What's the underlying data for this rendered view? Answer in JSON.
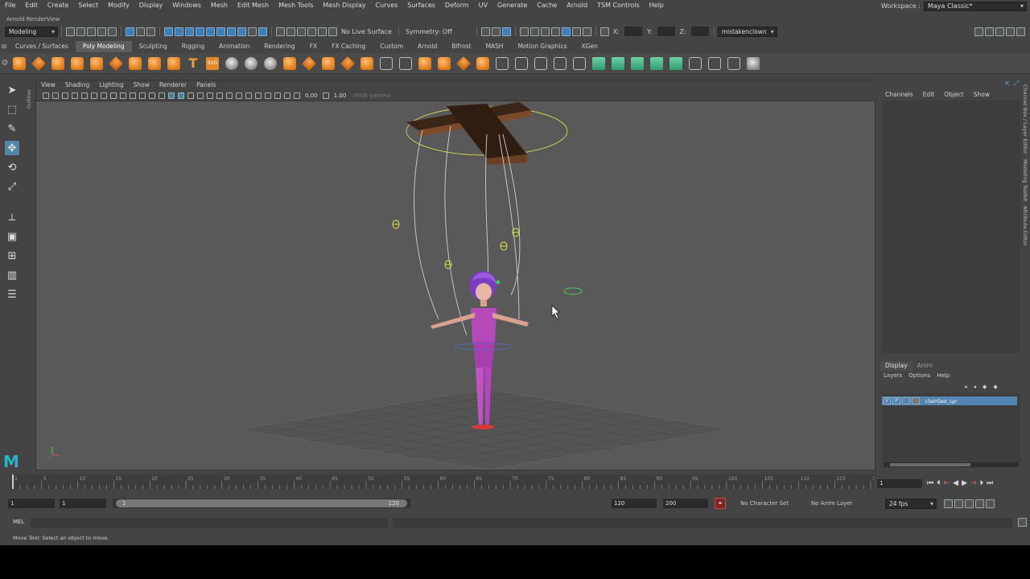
{
  "menubar": {
    "items": [
      "File",
      "Edit",
      "Create",
      "Select",
      "Modify",
      "Display",
      "Windows",
      "Mesh",
      "Edit Mesh",
      "Mesh Tools",
      "Mesh Display",
      "Curves",
      "Surfaces",
      "Deform",
      "UV",
      "Generate",
      "Cache",
      "Arnold",
      "TSM Controls",
      "Help"
    ],
    "workspace_label": "Workspace :",
    "workspace_value": "Maya Classic*"
  },
  "panel_title": "Arnold RenderView",
  "statusline": {
    "mode": "Modeling",
    "live_surface": "No Live Surface",
    "symmetry": "Symmetry: Off",
    "x_label": "X:",
    "y_label": "Y:",
    "z_label": "Z:",
    "user": "mistakenclown"
  },
  "shelf": {
    "tabs": [
      "Curves / Surfaces",
      "Poly Modeling",
      "Sculpting",
      "Rigging",
      "Animation",
      "Rendering",
      "FX",
      "FX Caching",
      "Custom",
      "Arnold",
      "Bifrost",
      "MASH",
      "Motion Graphics",
      "XGen"
    ],
    "active_tab": "Poly Modeling"
  },
  "viewport": {
    "menu": [
      "View",
      "Shading",
      "Lighting",
      "Show",
      "Renderer",
      "Panels"
    ],
    "exposure": "0.00",
    "gamma": "1.00",
    "color_space": "sRGB gamma",
    "camera_label": "persp"
  },
  "channelbox": {
    "menu": [
      "Channels",
      "Edit",
      "Object",
      "Show"
    ],
    "layer_tabs": [
      "Display",
      "Anim"
    ],
    "layer_menu": [
      "Layers",
      "Options",
      "Help"
    ],
    "layer": {
      "v": "V",
      "p": "P",
      "name": "clairGeo_Lyr"
    },
    "side_tabs": [
      "Channel Box / Layer Editor",
      "Modeling Toolkit",
      "Attribute Editor"
    ]
  },
  "timeslider": {
    "ticks": [
      "1",
      "5",
      "10",
      "15",
      "20",
      "25",
      "30",
      "35",
      "40",
      "45",
      "50",
      "55",
      "60",
      "65",
      "70",
      "75",
      "80",
      "85",
      "90",
      "95",
      "100",
      "105",
      "110",
      "115",
      "120"
    ],
    "current_frame": "1"
  },
  "rangeslider": {
    "start": "1",
    "inner_start": "1",
    "range_start": "1",
    "range_end": "120",
    "end": "120",
    "anim_end": "200",
    "character_set": "No Character Set",
    "anim_layer": "No Anim Layer",
    "fps": "24 fps"
  },
  "command": {
    "language": "MEL"
  },
  "helpline": {
    "text": "Move Tool: Select an object to move."
  },
  "colors": {
    "accent": "#5285b2",
    "background": "#444444",
    "viewport": "#595959",
    "character": "#c24fc6"
  }
}
